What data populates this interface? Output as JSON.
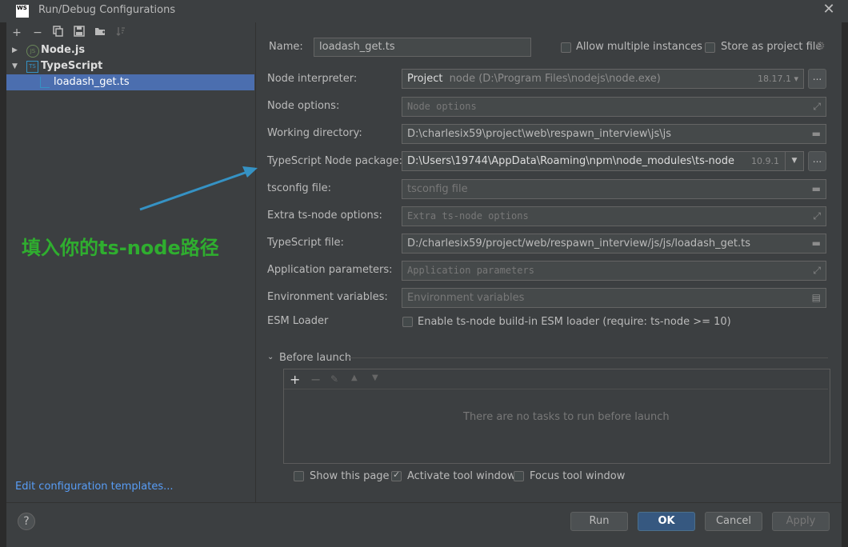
{
  "window": {
    "title": "Run/Debug Configurations",
    "logo_line1": "WS",
    "close_glyph": "✕"
  },
  "toolbar": {
    "add": "+",
    "remove": "−",
    "copy_icon": "copy-icon",
    "save_icon": "save-icon",
    "folder_icon": "new-folder-icon",
    "sort_icon": "sort-icon"
  },
  "tree": [
    {
      "label": "Node.js",
      "icon": "nodejs-icon",
      "icon_text": "JS"
    },
    {
      "label": "TypeScript",
      "icon": "typescript-icon",
      "icon_text": "TS"
    },
    {
      "label": "loadash_get.ts",
      "icon": "ts-file-icon",
      "icon_text": "TS"
    }
  ],
  "edit_templates": "Edit configuration templates...",
  "name_field": {
    "label": "Name:",
    "value": "loadash_get.ts"
  },
  "allow_multiple": "Allow multiple instances",
  "store_project": "Store as project file",
  "fields": {
    "node_interpreter": {
      "label": "Node interpreter:",
      "value_prefix": "Project",
      "value": "node (D:\\Program Files\\nodejs\\node.exe)",
      "version": "18.17.1"
    },
    "node_options": {
      "label": "Node options:",
      "placeholder": "Node options"
    },
    "working_directory": {
      "label": "Working directory:",
      "value": "D:\\charlesix59\\project\\web\\respawn_interview\\js\\js"
    },
    "ts_node_package": {
      "label": "TypeScript Node package:",
      "value": "D:\\Users\\19744\\AppData\\Roaming\\npm\\node_modules\\ts-node",
      "version": "10.9.1"
    },
    "tsconfig": {
      "label": "tsconfig file:",
      "placeholder": "tsconfig file"
    },
    "extra_ts_node": {
      "label": "Extra ts-node options:",
      "placeholder": "Extra ts-node options"
    },
    "typescript_file": {
      "label": "TypeScript file:",
      "value": "D:/charlesix59/project/web/respawn_interview/js/js/loadash_get.ts"
    },
    "app_params": {
      "label": "Application parameters:",
      "placeholder": "Application parameters"
    },
    "env_vars": {
      "label": "Environment variables:",
      "placeholder": "Environment variables"
    },
    "esm_loader": {
      "label": "ESM Loader",
      "checkbox_label": "Enable ts-node build-in ESM loader (require: ts-node >= 10)"
    }
  },
  "dots": "...",
  "before_launch": {
    "title": "Before launch",
    "empty_text": "There are no tasks to run before launch",
    "add": "+",
    "remove": "−"
  },
  "options": {
    "show_page": "Show this page",
    "activate_tool": "Activate tool window",
    "focus_tool": "Focus tool window"
  },
  "buttons": {
    "help": "?",
    "run": "Run",
    "ok": "OK",
    "cancel": "Cancel",
    "apply": "Apply"
  },
  "annotation": "填入你的ts-node路径",
  "colors": {
    "annotation": "#2fae2f",
    "arrow": "#3592c4",
    "selection": "#4b6eaf",
    "link": "#589df6"
  }
}
